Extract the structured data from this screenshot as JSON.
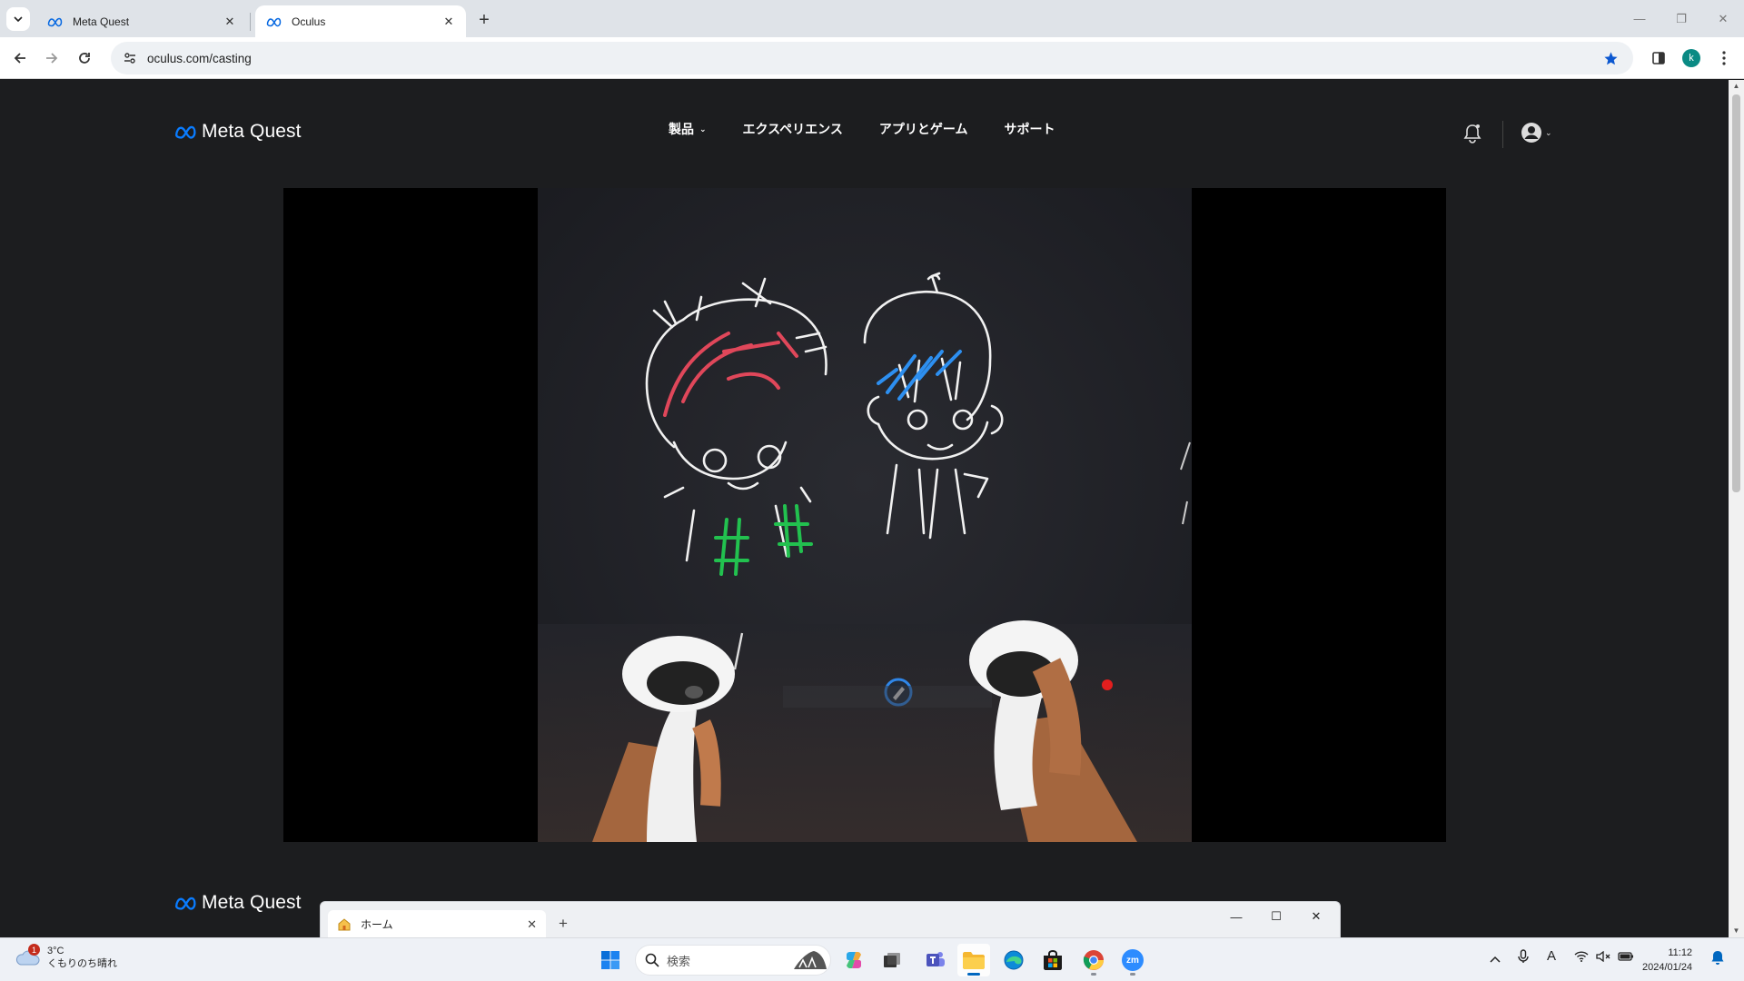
{
  "browser": {
    "tabs": [
      {
        "title": "Meta Quest",
        "active": false
      },
      {
        "title": "Oculus",
        "active": true
      }
    ],
    "url": "oculus.com/casting",
    "profile_initial": "k"
  },
  "site": {
    "logo_text": "Meta Quest",
    "nav": [
      {
        "label": "製品",
        "has_dropdown": true
      },
      {
        "label": "エクスペリエンス",
        "has_dropdown": false
      },
      {
        "label": "アプリとゲーム",
        "has_dropdown": false
      },
      {
        "label": "サポート",
        "has_dropdown": false
      }
    ],
    "footer_logo_text": "Meta Quest"
  },
  "explorer": {
    "tab_title": "ホーム"
  },
  "taskbar": {
    "weather": {
      "temp": "3°C",
      "condition": "くもりのち晴れ",
      "badge": "1"
    },
    "search_placeholder": "検索",
    "time": "11:12",
    "date": "2024/01/24",
    "apps": [
      "start-icon",
      "copilot-icon",
      "task-view-icon",
      "teams-icon",
      "file-explorer-icon",
      "edge-icon",
      "store-icon",
      "chrome-icon",
      "zoom-icon"
    ],
    "zoom_label": "zm"
  },
  "colors": {
    "page_bg": "#1c1d1f",
    "meta_blue": "#0668e1",
    "taskbar_bg": "#eef1f6"
  }
}
